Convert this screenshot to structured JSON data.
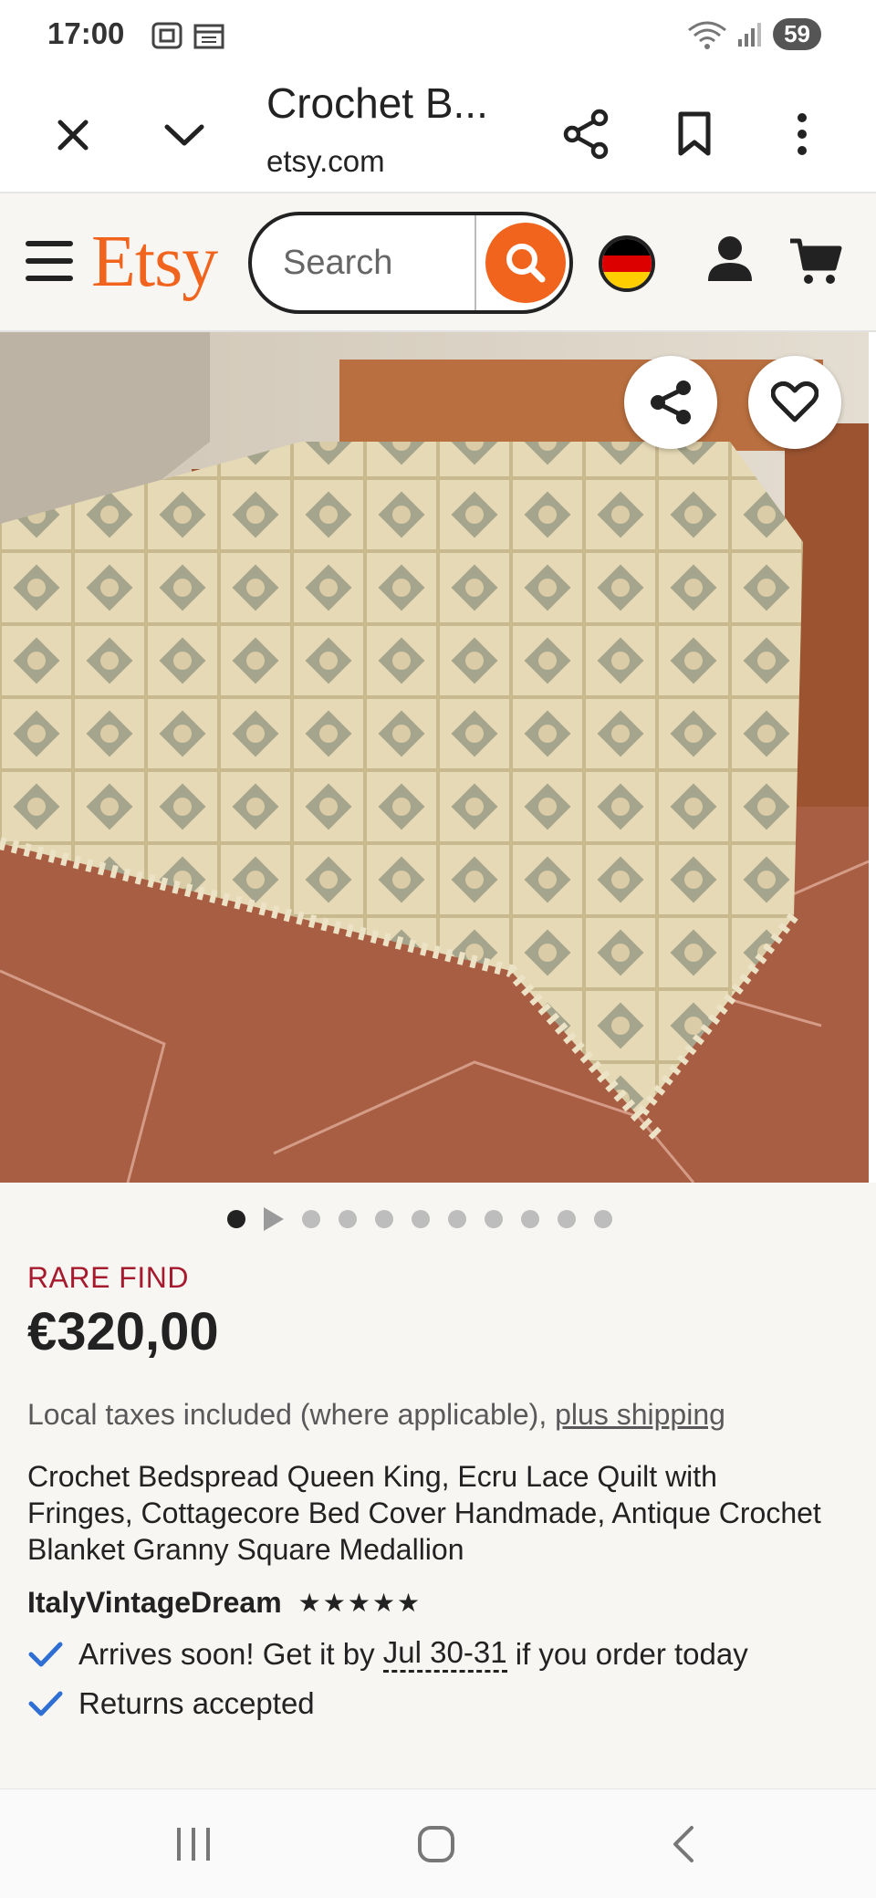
{
  "status_bar": {
    "time": "17:00",
    "battery": "59"
  },
  "browser": {
    "title": "Crochet B...",
    "url": "etsy.com"
  },
  "header": {
    "logo": "Etsy",
    "search_placeholder": "Search",
    "flag_colors": [
      "#000000",
      "#dd0000",
      "#ffce00"
    ]
  },
  "carousel": {
    "total_images": 11,
    "active_index": 0,
    "video_index": 1
  },
  "product": {
    "badge": "RARE FIND",
    "price": "€320,00",
    "taxes_text": "Local taxes included (where applicable), ",
    "shipping_link": "plus shipping",
    "title": "Crochet Bedspread Queen King, Ecru Lace Quilt with Fringes, Cottagecore Bed Cover Handmade, Antique Crochet Blanket Granny Square Medallion",
    "shop_name": "ItalyVintageDream",
    "rating_stars": 5,
    "stars_text": "★★★★★",
    "delivery_prefix": "Arrives soon! Get it by ",
    "delivery_dates": "Jul 30-31",
    "delivery_suffix": " if you order today",
    "returns": "Returns accepted"
  },
  "colors": {
    "brand": "#f1641e",
    "rare_find": "#a61a2e",
    "check": "#2f6fd3"
  }
}
